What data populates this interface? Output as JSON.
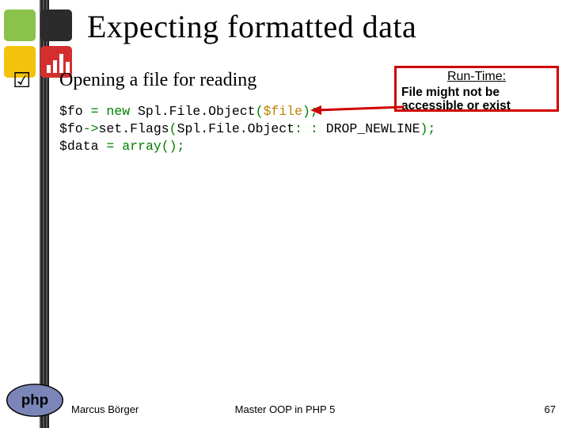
{
  "title": "Expecting formatted data",
  "bullet_icon": "☑",
  "subtitle": "Opening a file for reading",
  "annotation": {
    "heading": "Run-Time:",
    "body": "File might not be accessible or exist"
  },
  "code": {
    "l1_a": "$fo ",
    "l1_b": "= new ",
    "l1_c": "Spl.File.Object",
    "l1_d": "(",
    "l1_e": "$file",
    "l1_f": ");",
    "l2_a": "$fo",
    "l2_b": "->",
    "l2_c": "set.Flags",
    "l2_d": "(",
    "l2_e": "Spl.File.Object",
    "l2_f": ": : ",
    "l2_g": "DROP_NEWLINE",
    "l2_h": ");",
    "l3_a": "$data ",
    "l3_b": "= ",
    "l3_c": "array",
    "l3_d": "();"
  },
  "footer": {
    "author": "Marcus Börger",
    "center": "Master OOP in PHP 5",
    "page": "67"
  }
}
